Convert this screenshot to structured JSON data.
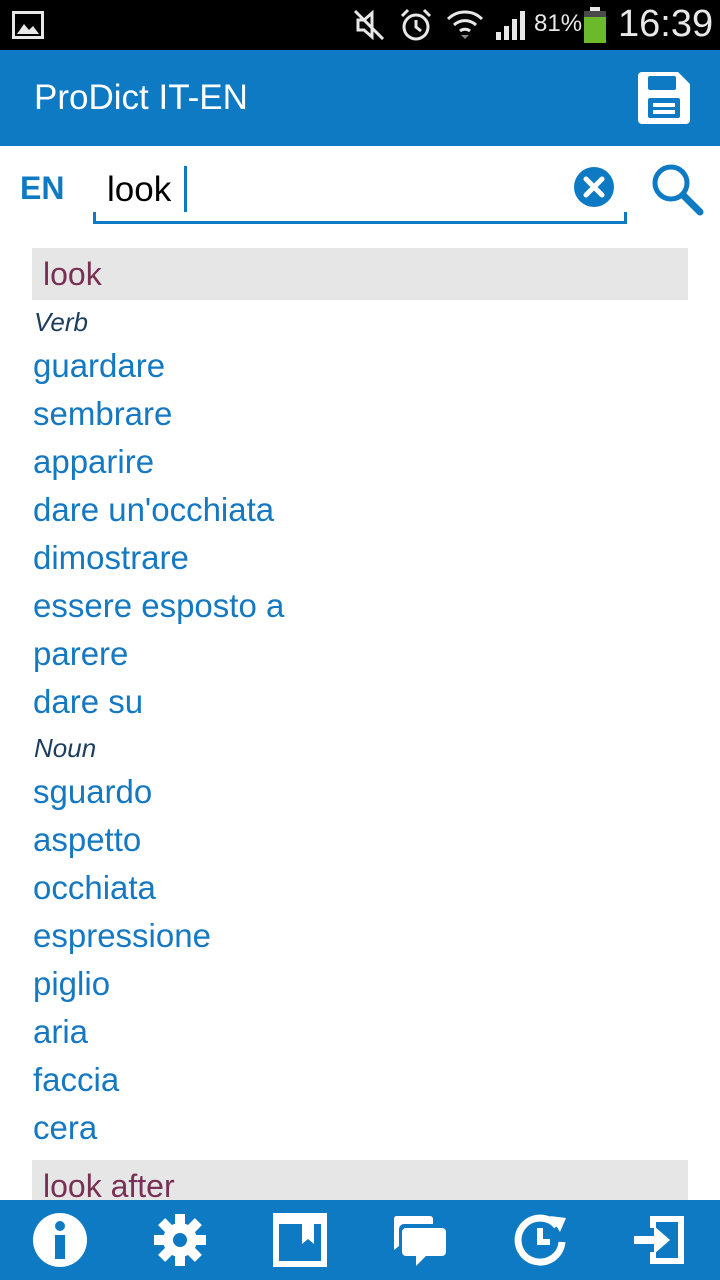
{
  "status_bar": {
    "battery_percent": "81%",
    "time": "16:39",
    "icons": [
      "gallery-notification-icon",
      "mute-icon",
      "alarm-icon",
      "wifi-icon",
      "signal-icon",
      "battery-icon"
    ]
  },
  "app_bar": {
    "title": "ProDict IT-EN",
    "save_icon": "save-icon"
  },
  "search": {
    "language": "EN",
    "query": "look",
    "clear_icon": "clear-icon",
    "search_icon": "search-icon"
  },
  "results": {
    "entry1": {
      "headword": "look",
      "verb_label": "Verb",
      "verbs": [
        "guardare",
        "sembrare",
        "apparire",
        "dare un'occhiata",
        "dimostrare",
        "essere esposto a",
        "parere",
        "dare su"
      ],
      "noun_label": "Noun",
      "nouns": [
        "sguardo",
        "aspetto",
        "occhiata",
        "espressione",
        "piglio",
        "aria",
        "faccia",
        "cera"
      ]
    },
    "entry2": {
      "headword": "look after"
    }
  },
  "bottom_bar": {
    "icons": [
      "info-icon",
      "settings-icon",
      "bookmarks-icon",
      "feedback-icon",
      "history-icon",
      "exit-icon"
    ]
  },
  "colors": {
    "primary": "#0e7ac4",
    "headword": "#7a2f55",
    "translation": "#1578c2",
    "headword_bg": "#e6e6e6"
  }
}
